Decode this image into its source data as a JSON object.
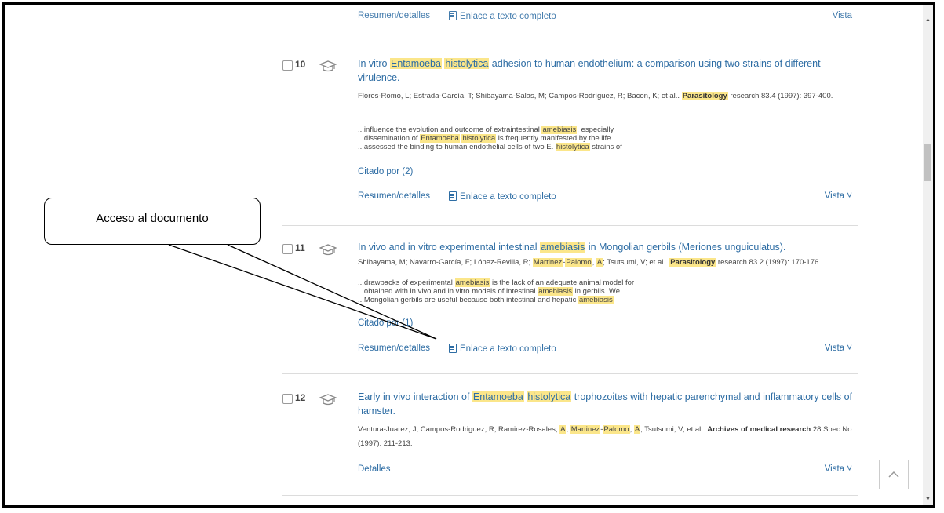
{
  "top_partial": {
    "abstract_link": "Resumen/detalles",
    "fulltext_link": "Enlace a texto completo",
    "vista": "Vista"
  },
  "results": [
    {
      "number": "10",
      "title_parts": [
        "In vitro ",
        "Entamoeba",
        " ",
        "histolytica",
        " adhesion to human endothelium: a comparison using two strains of different virulence."
      ],
      "authors": "Flores-Romo, L; Estrada-García, T; Shibayama-Salas, M; Campos-Rodríguez, R; Bacon, K; et al.. ",
      "journal_bold": "Parasitology",
      "citation": " research 83.4  (1997): 397-400.",
      "snippets": [
        [
          "...influence the evolution and outcome of extraintestinal ",
          "amebiasis",
          ", especially"
        ],
        [
          "...dissemination of ",
          "Entamoeba",
          " ",
          "histolytica",
          " is frequently manifested by the life"
        ],
        [
          "...assessed the binding to human endothelial cells of two E. ",
          "histolytica",
          " strains of"
        ]
      ],
      "cited": "Citado por (2)",
      "abstract_link": "Resumen/detalles",
      "fulltext_link": "Enlace a texto completo",
      "vista": "Vista ˅"
    },
    {
      "number": "11",
      "title_parts": [
        "In vivo and in vitro experimental intestinal ",
        "amebiasis",
        " in Mongolian gerbils (Meriones unguiculatus)."
      ],
      "authors": "Shibayama, M; Navarro-García, F; López-Revilla, R; ",
      "authors_hl": [
        "Martinez",
        "-",
        "Palomo",
        ", ",
        "A"
      ],
      "authors_tail": "; Tsutsumi, V; et al.. ",
      "journal_bold": "Parasitology",
      "citation": " research 83.2  (1997): 170-176.",
      "snippets": [
        [
          "...drawbacks of experimental ",
          "amebiasis",
          " is the lack of an adequate animal model for"
        ],
        [
          "...obtained with in vivo and in vitro models of intestinal ",
          "amebiasis",
          " in gerbils. We"
        ],
        [
          "...Mongolian gerbils are useful because both intestinal and hepatic ",
          "amebiasis",
          ""
        ]
      ],
      "cited": "Citado por (1)",
      "abstract_link": "Resumen/detalles",
      "fulltext_link": "Enlace a texto completo",
      "vista": "Vista ˅"
    },
    {
      "number": "12",
      "title_parts": [
        "Early in vivo interaction of ",
        "Entamoeba",
        " ",
        "histolytica",
        " trophozoites with hepatic parenchymal and inflammatory cells of hamster."
      ],
      "authors": "Ventura-Juarez, J; Campos-Rodriguez, R; Ramirez-Rosales, ",
      "authors_hl": [
        "A",
        "; ",
        "Martinez",
        "-",
        "Palomo",
        ", ",
        "A"
      ],
      "authors_tail": "; Tsutsumi, V; et al.. ",
      "journal_bold": "Archives of medical research",
      "citation": " 28 Spec No  (1997): 211-213.",
      "detail_link": "Detalles",
      "vista": "Vista ˅"
    }
  ],
  "callout": {
    "text": "Acceso al documento"
  },
  "icons": {
    "mortarboard": "graduation-cap-icon",
    "fulltext": "document-icon",
    "back_to_top": "chevron-up-icon"
  }
}
